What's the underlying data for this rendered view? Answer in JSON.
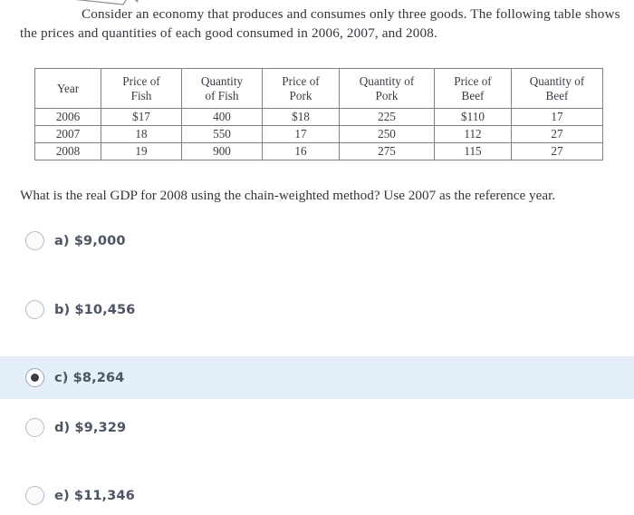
{
  "prompt": {
    "text": "Consider an economy that produces and consumes only three goods. The following table shows the prices and quantities of each good consumed in 2006, 2007, and 2008."
  },
  "table": {
    "headers": [
      "Year",
      "Price of Fish",
      "Quantity of Fish",
      "Price of Pork",
      "Quantity of Pork",
      "Price of Beef",
      "Quantity of Beef"
    ],
    "headers_line1": [
      "Year",
      "Price of",
      "Quantity",
      "Price of",
      "Quantity of",
      "Price of",
      "Quantity of"
    ],
    "headers_line2": [
      "",
      "Fish",
      "of Fish",
      "Pork",
      "Pork",
      "Beef",
      "Beef"
    ],
    "rows": [
      [
        "2006",
        "$17",
        "400",
        "$18",
        "225",
        "$110",
        "17"
      ],
      [
        "2007",
        "18",
        "550",
        "17",
        "250",
        "112",
        "27"
      ],
      [
        "2008",
        "19",
        "900",
        "16",
        "275",
        "115",
        "27"
      ]
    ]
  },
  "question": {
    "text": "What is the real GDP for 2008 using the chain-weighted method?  Use 2007 as the reference year."
  },
  "options": [
    {
      "id": "a",
      "label": "a) $9,000",
      "selected": false
    },
    {
      "id": "b",
      "label": "b) $10,456",
      "selected": false
    },
    {
      "id": "c",
      "label": "c) $8,264",
      "selected": true
    },
    {
      "id": "d",
      "label": "d) $9,329",
      "selected": false
    },
    {
      "id": "e",
      "label": "e) $11,346",
      "selected": false
    }
  ],
  "colors": {
    "selected_row_background": "#e4eff9",
    "radio_border": "#b3bcc6",
    "radio_dot": "#3d3d46",
    "option_text": "#4b5563",
    "body_text": "#34343c",
    "table_border": "#808089",
    "page_background": "#ffffff"
  }
}
